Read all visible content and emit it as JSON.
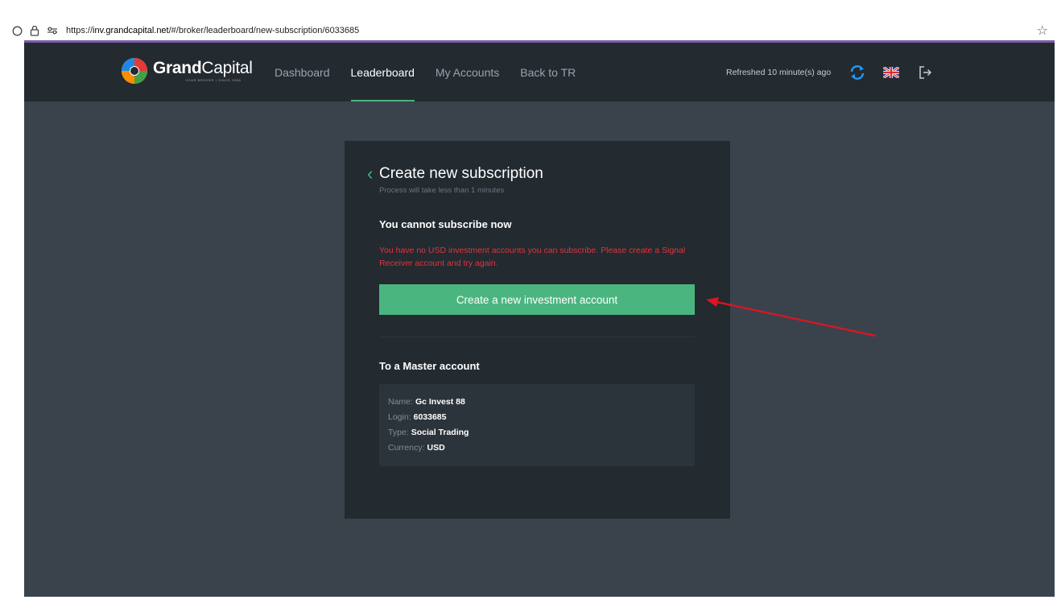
{
  "browser": {
    "url_prefix": "https://",
    "url_host": "inv.grandcapital.net",
    "url_path": "/#/broker/leaderboard/new-subscription/6033685"
  },
  "brand": {
    "name_bold": "Grand",
    "name_light": "Capital",
    "tagline": "YOUR BROKER | SINCE 2006"
  },
  "nav": {
    "items": [
      {
        "label": "Dashboard",
        "active": false
      },
      {
        "label": "Leaderboard",
        "active": true
      },
      {
        "label": "My Accounts",
        "active": false
      },
      {
        "label": "Back to TR",
        "active": false
      }
    ],
    "refreshed": "Refreshed 10 minute(s) ago"
  },
  "card": {
    "title": "Create new subscription",
    "subtitle": "Process will take less than 1 minutes",
    "status_title": "You cannot subscribe now",
    "error_message": "You have no USD investment accounts you can subscribe. Please create a Signal Receiver account and try again.",
    "create_button": "Create a new investment account",
    "master_title": "To a Master account",
    "master": {
      "name_label": "Name:",
      "name_value": "Gc Invest 88",
      "login_label": "Login:",
      "login_value": "6033685",
      "type_label": "Type:",
      "type_value": "Social Trading",
      "currency_label": "Currency:",
      "currency_value": "USD"
    }
  },
  "colors": {
    "accent": "#4ab57f",
    "error": "#e0343e",
    "nav_bg": "#232a30",
    "page_bg": "#3a434c",
    "annotation": "#e0141e"
  },
  "icons": [
    "circle-icon",
    "lock-icon",
    "permissions-icon",
    "star-icon",
    "sync-icon",
    "uk-flag-icon",
    "logout-icon",
    "chevron-left-icon"
  ]
}
